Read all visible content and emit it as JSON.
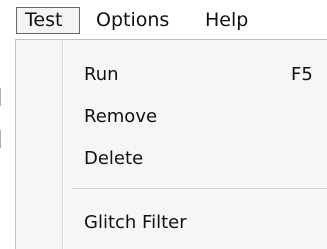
{
  "menubar": {
    "items": [
      {
        "label": "Test"
      },
      {
        "label": "Options"
      },
      {
        "label": "Help"
      }
    ]
  },
  "menu": {
    "items": [
      {
        "label": "Run",
        "shortcut": "F5"
      },
      {
        "label": "Remove",
        "shortcut": ""
      },
      {
        "label": "Delete",
        "shortcut": ""
      },
      {
        "label": "Glitch Filter",
        "shortcut": ""
      }
    ]
  }
}
